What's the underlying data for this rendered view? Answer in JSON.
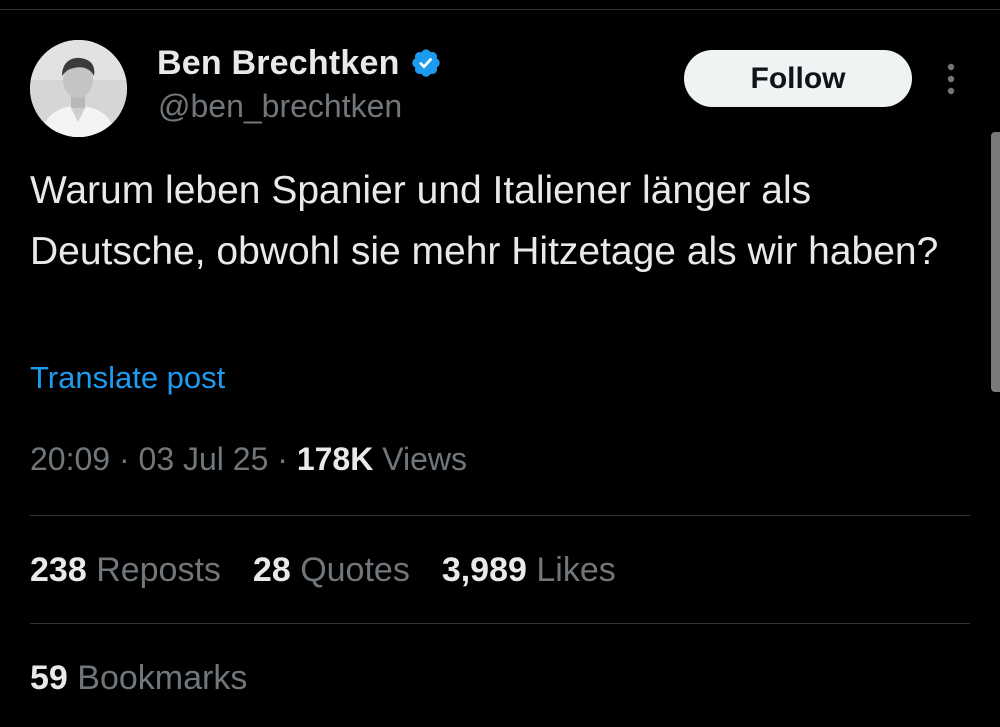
{
  "author": {
    "name": "Ben Brechtken",
    "handle": "@ben_brechtken",
    "verified_icon": "verified-badge-icon",
    "verified_color": "#1d9bf0"
  },
  "actions": {
    "follow_label": "Follow",
    "more_icon": "more-vertical-icon"
  },
  "post": {
    "text": "Warum leben Spanier und Italiener länger als Deutsche, obwohl sie mehr Hitzetage als wir haben?",
    "translate_label": "Translate post"
  },
  "meta": {
    "time": "20:09",
    "separator": "·",
    "date": "03 Jul 25",
    "views_count": "178K",
    "views_label": "Views"
  },
  "stats": {
    "reposts_count": "238",
    "reposts_label": "Reposts",
    "quotes_count": "28",
    "quotes_label": "Quotes",
    "likes_count": "3,989",
    "likes_label": "Likes",
    "bookmarks_count": "59",
    "bookmarks_label": "Bookmarks"
  },
  "colors": {
    "background": "#000000",
    "primary_text": "#e7e9ea",
    "secondary_text": "#71767b",
    "link": "#1d9bf0",
    "divider": "#2f3336",
    "follow_button_bg": "#eff3f4"
  }
}
